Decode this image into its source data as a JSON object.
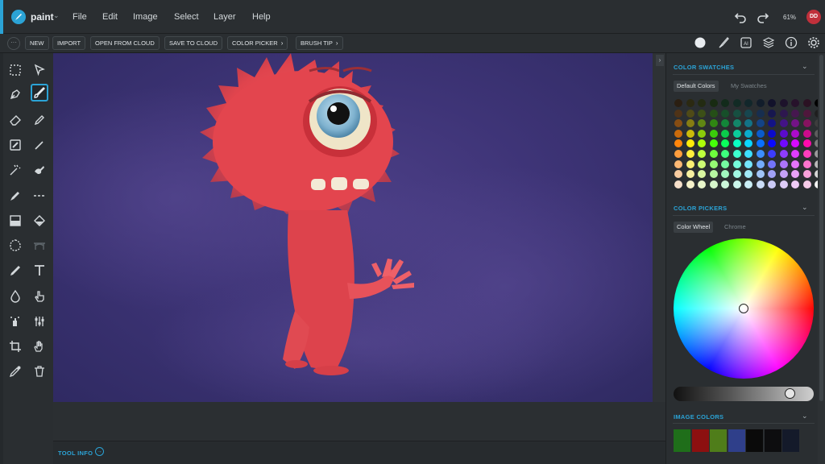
{
  "app": {
    "name": "paint",
    "zoom": "61%",
    "user_initials": "DD",
    "accent": "#2ba3d6"
  },
  "menu": [
    "File",
    "Edit",
    "Image",
    "Select",
    "Layer",
    "Help"
  ],
  "toolbar": {
    "new": "NEW",
    "import": "IMPORT",
    "open_cloud": "OPEN FROM CLOUD",
    "save_cloud": "SAVE TO CLOUD",
    "color_picker": "COLOR PICKER",
    "brush_tip": "BRUSH TIP"
  },
  "panel_tabs": [
    "color-tab-icon",
    "brush-tab-icon",
    "ai-tab-icon",
    "layers-tab-icon",
    "info-tab-icon",
    "settings-tab-icon"
  ],
  "tools": [
    "marquee-icon",
    "select-arrow-icon",
    "pen-icon",
    "brush-icon",
    "eraser-icon",
    "pencil-icon",
    "transform-icon",
    "line-pencil-icon",
    "magic-icon",
    "smudge-icon",
    "marker-icon",
    "dashed-line-icon",
    "gradient-icon",
    "fill-bucket-icon",
    "lasso-blob-icon",
    "bridge-icon",
    "eyedropper-fill-icon",
    "text-icon",
    "drop-icon",
    "hand-pointer-icon",
    "spray-icon",
    "adjust-icon",
    "crop-icon",
    "pan-hand-icon",
    "color-picker-icon",
    "trash-icon"
  ],
  "status": {
    "tool_info": "TOOL INFO"
  },
  "color_swatches": {
    "title": "COLOR SWATCHES",
    "tabs": [
      "Default Colors",
      "My Swatches"
    ],
    "active_tab": "Default Colors"
  },
  "color_pickers": {
    "title": "COLOR PICKERS",
    "tabs": [
      "Color Wheel",
      "Chrome"
    ],
    "active_tab": "Color Wheel"
  },
  "image_colors": {
    "title": "IMAGE COLORS",
    "colors": [
      "#1f6e1a",
      "#8c1010",
      "#4f7d1a",
      "#2f3f8a",
      "#0a0a0a",
      "#0d0d0f",
      "#141a2a"
    ]
  }
}
